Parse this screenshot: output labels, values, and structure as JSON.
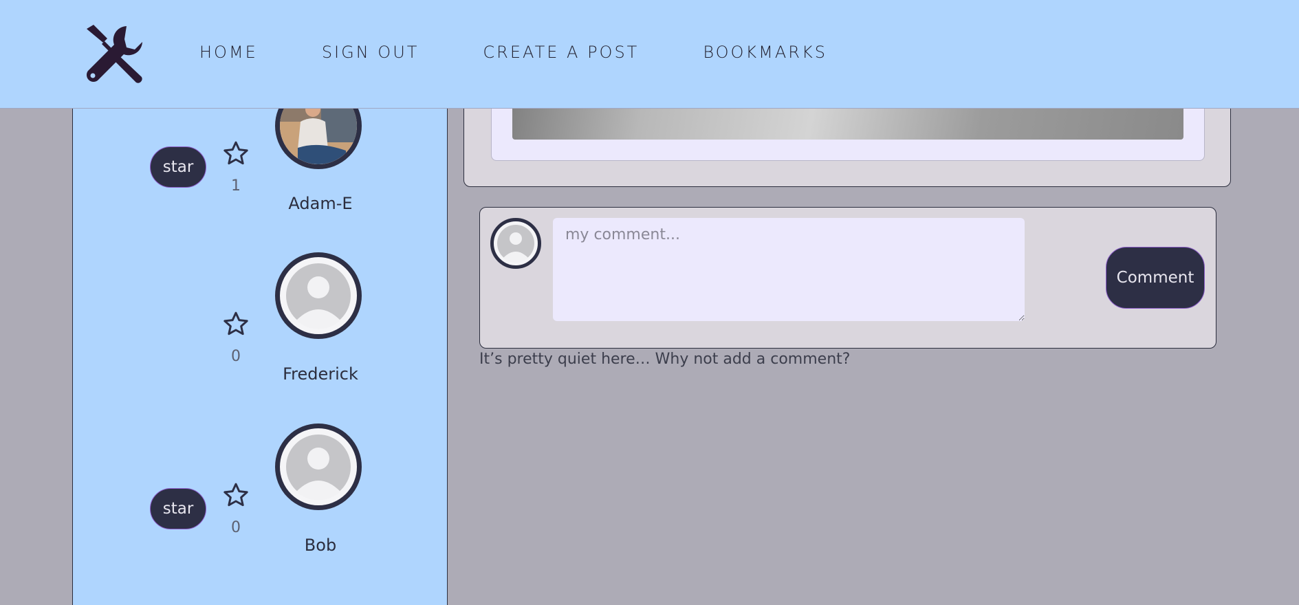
{
  "header": {
    "logo_icon": "tools-icon",
    "nav": [
      {
        "label": "HOME"
      },
      {
        "label": "SIGN OUT"
      },
      {
        "label": "CREATE A POST"
      },
      {
        "label": "BOOKMARKS"
      }
    ]
  },
  "sidebar": {
    "users": [
      {
        "name": "Adam-E",
        "stars": "1",
        "star_button": "star",
        "avatar": "photo"
      },
      {
        "name": "Frederick",
        "stars": "0",
        "avatar": "default"
      },
      {
        "name": "Bob",
        "stars": "0",
        "star_button": "star",
        "avatar": "default"
      }
    ]
  },
  "comment_form": {
    "placeholder": "my comment...",
    "submit_label": "Comment"
  },
  "comments": {
    "empty_message": "It’s pretty quiet here… Why not add a comment?"
  },
  "colors": {
    "header_bg": "#afd5fe",
    "page_bg": "#adabb6",
    "button_bg": "#2d2f45",
    "button_border": "#8a5bc8"
  }
}
